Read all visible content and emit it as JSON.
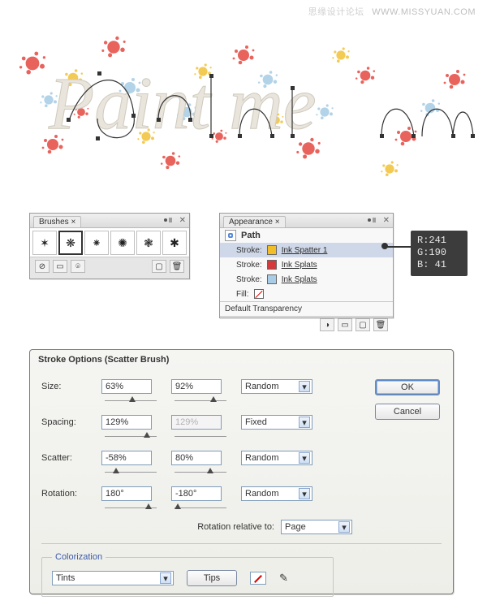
{
  "watermark": {
    "cn": "思缘设计论坛",
    "en": "WWW.MISSYUAN.COM"
  },
  "art_text": "Paint me",
  "panels": {
    "brushes": {
      "title": "Brushes"
    },
    "appearance": {
      "title": "Appearance",
      "object_label": "Path",
      "rows": [
        {
          "label": "Stroke:",
          "color": "#f1be29",
          "name": "Ink Spatter 1",
          "selected": true
        },
        {
          "label": "Stroke:",
          "color": "#d53a3a",
          "name": "Ink Splats",
          "selected": false
        },
        {
          "label": "Stroke:",
          "color": "#a9cde6",
          "name": "Ink Splats",
          "selected": false
        }
      ],
      "fill_label": "Fill:",
      "transparency": "Default Transparency"
    }
  },
  "callout": {
    "r_label": "R:",
    "r": "241",
    "g_label": "G:",
    "g": "190",
    "b_label": "B:",
    "b": " 41"
  },
  "dialog": {
    "title": "Stroke Options (Scatter Brush)",
    "rows": {
      "size": {
        "label": "Size:",
        "v1": "63%",
        "v2": "92%",
        "mode": "Random"
      },
      "spacing": {
        "label": "Spacing:",
        "v1": "129%",
        "v2": "129%",
        "mode": "Fixed",
        "v2_disabled": true
      },
      "scatter": {
        "label": "Scatter:",
        "v1": "-58%",
        "v2": "80%",
        "mode": "Random"
      },
      "rotation": {
        "label": "Rotation:",
        "v1": "180°",
        "v2": "-180°",
        "mode": "Random"
      }
    },
    "rotation_relative_label": "Rotation relative to:",
    "rotation_relative_value": "Page",
    "colorization": {
      "legend": "Colorization",
      "method": "Tints",
      "tips": "Tips"
    },
    "buttons": {
      "ok": "OK",
      "cancel": "Cancel"
    }
  }
}
